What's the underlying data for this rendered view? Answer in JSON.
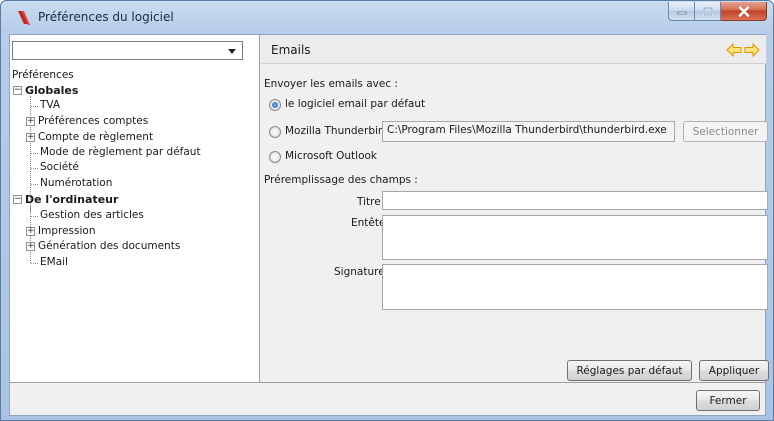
{
  "window": {
    "title": "Préférences du logiciel"
  },
  "left": {
    "combo_value": "",
    "tree_root": "Préférences",
    "groups": [
      {
        "label": "Globales",
        "items": [
          {
            "label": "TVA",
            "expandable": false
          },
          {
            "label": "Préférences comptes",
            "expandable": true
          },
          {
            "label": "Compte de règlement",
            "expandable": true
          },
          {
            "label": "Mode de règlement par défaut",
            "expandable": false
          },
          {
            "label": "Société",
            "expandable": false
          },
          {
            "label": "Numérotation",
            "expandable": false
          }
        ]
      },
      {
        "label": "De l'ordinateur",
        "items": [
          {
            "label": "Gestion des articles",
            "expandable": false
          },
          {
            "label": "Impression",
            "expandable": true
          },
          {
            "label": "Génération des documents",
            "expandable": true
          },
          {
            "label": "EMail",
            "expandable": false
          }
        ]
      }
    ]
  },
  "panel": {
    "title": "Emails",
    "send_with_label": "Envoyer les emails avec :",
    "options": {
      "default": "le logiciel email par défaut",
      "thunderbird": "Mozilla Thunderbird",
      "outlook": "Microsoft Outlook"
    },
    "selected_option": "default",
    "thunderbird_path": "C:\\Program Files\\Mozilla Thunderbird\\thunderbird.exe",
    "select_button": "Selectionner",
    "prefill_label": "Préremplissage des champs :",
    "fields": {
      "title_label": "Titre",
      "title_value": "",
      "header_label": "Entête",
      "header_value": "",
      "signature_label": "Signature",
      "signature_value": ""
    },
    "defaults_button": "Réglages par défaut",
    "apply_button": "Appliquer"
  },
  "footer": {
    "close_button": "Fermer"
  },
  "colors": {
    "nav_arrow": "#f0b400",
    "close_button": "#c24127",
    "radio_checked": "#1e62b0"
  }
}
